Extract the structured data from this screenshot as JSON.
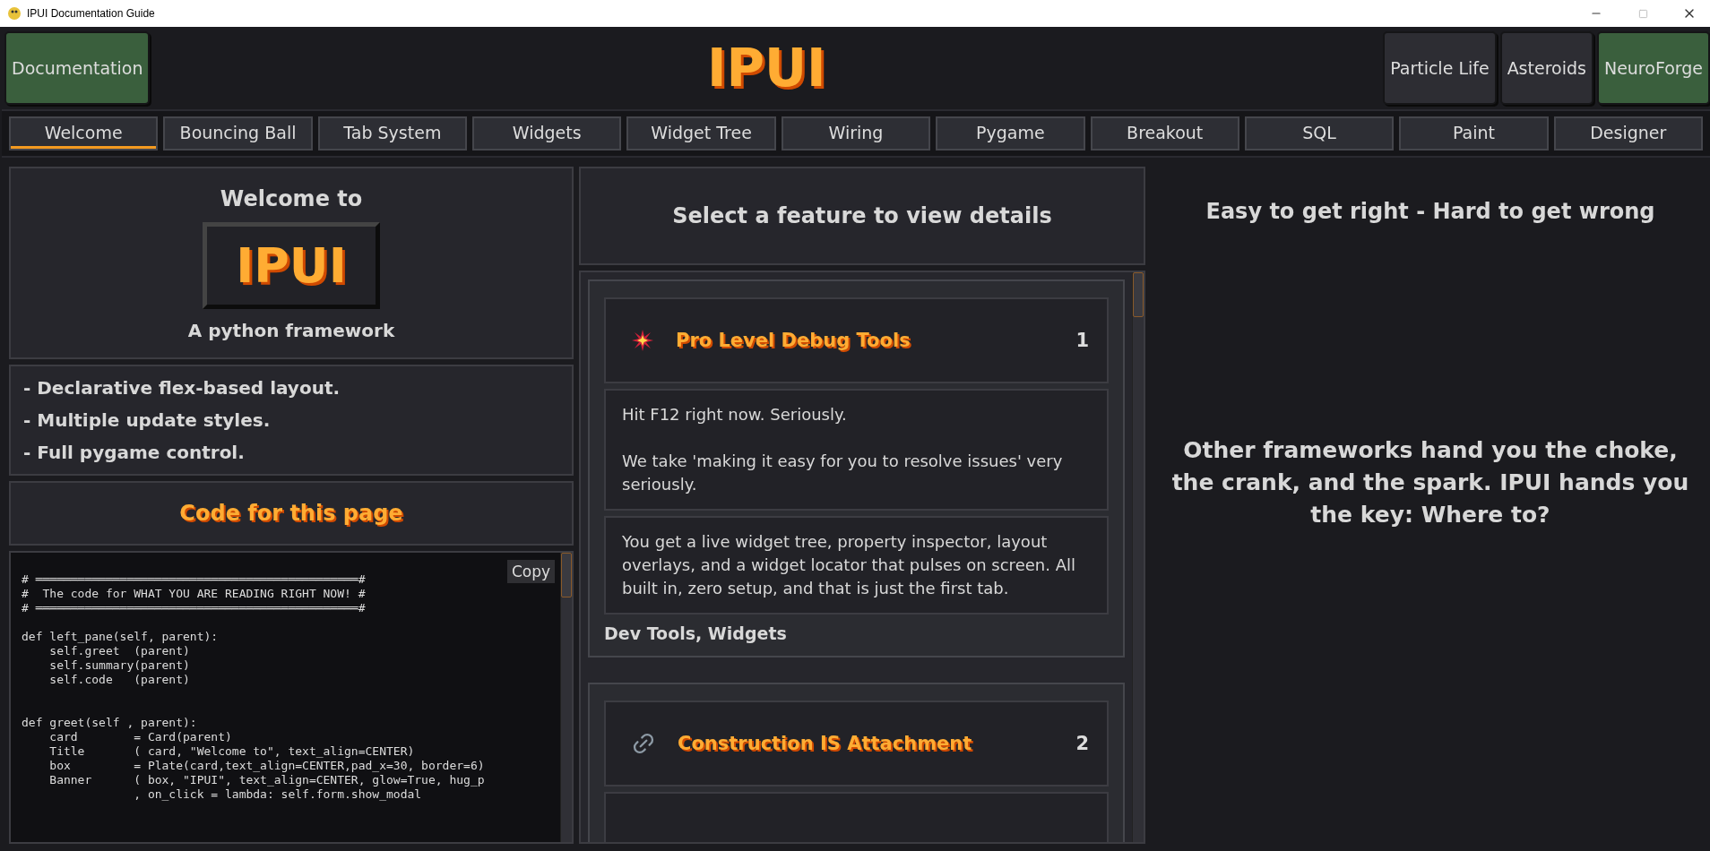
{
  "window": {
    "title": "IPUI Documentation Guide"
  },
  "header": {
    "title": "IPUI",
    "left_buttons": [
      {
        "label": "Documentation",
        "kind": "accent"
      }
    ],
    "right_buttons": [
      {
        "label": "Particle Life",
        "kind": "plain"
      },
      {
        "label": "Asteroids",
        "kind": "plain"
      },
      {
        "label": "NeuroForge",
        "kind": "accent"
      }
    ]
  },
  "tabs": [
    {
      "label": "Welcome",
      "selected": true
    },
    {
      "label": "Bouncing Ball",
      "selected": false
    },
    {
      "label": "Tab System",
      "selected": false
    },
    {
      "label": "Widgets",
      "selected": false
    },
    {
      "label": "Widget Tree",
      "selected": false
    },
    {
      "label": "Wiring",
      "selected": false
    },
    {
      "label": "Pygame",
      "selected": false
    },
    {
      "label": "Breakout",
      "selected": false
    },
    {
      "label": "SQL",
      "selected": false
    },
    {
      "label": "Paint",
      "selected": false
    },
    {
      "label": "Designer",
      "selected": false
    }
  ],
  "left_pane": {
    "greeting": {
      "title": "Welcome to",
      "banner": "IPUI",
      "subtitle": "A python framework"
    },
    "summary": [
      "- Declarative flex-based layout.",
      "- Multiple update styles.",
      "- Full pygame control."
    ],
    "code_title": "Code for this page",
    "copy_button": "Copy",
    "code": "# ══════════════════════════════════════════════#\n#  The code for WHAT YOU ARE READING RIGHT NOW! #\n# ══════════════════════════════════════════════#\n\ndef left_pane(self, parent):\n    self.greet  (parent)\n    self.summary(parent)\n    self.code   (parent)\n\n\ndef greet(self , parent):\n    card        = Card(parent)\n    Title       ( card, \"Welcome to\", text_align=CENTER)\n    box         = Plate(card,text_align=CENTER,pad_x=30, border=6)\n    Banner      ( box, \"IPUI\", text_align=CENTER, glow=True, hug_p\n                , on_click = lambda: self.form.show_modal"
  },
  "middle_pane": {
    "heading": "Select a feature to view details",
    "features": [
      {
        "kind": "burst",
        "title": "Pro Level Debug Tools",
        "number": "1",
        "paragraphs": [
          "Hit F12 right now. Seriously.\n\nWe take 'making it easy for you to resolve issues' very seriously.",
          "You get a live widget tree, property inspector, layout overlays, and a widget locator that pulses on screen. All built in, zero setup, and that is just the first tab."
        ],
        "tags": "Dev Tools, Widgets"
      },
      {
        "kind": "link",
        "title": "Construction IS Attachment",
        "number": "2"
      }
    ]
  },
  "right_pane": {
    "heading": "Easy to get right - Hard to get wrong",
    "body": "Other frameworks hand you the choke, the crank, and the spark. IPUI hands you the key: Where to?"
  }
}
